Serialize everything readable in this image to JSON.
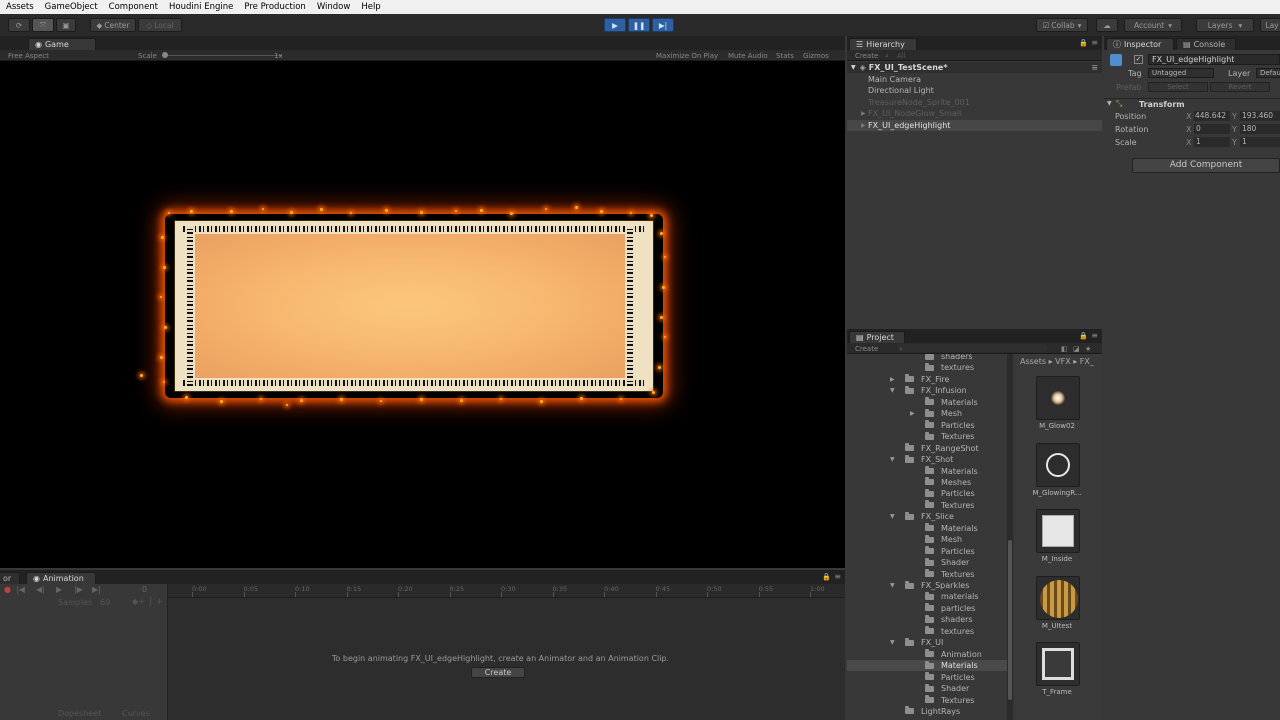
{
  "menu": [
    "Assets",
    "GameObject",
    "Component",
    "Houdini Engine",
    "Pre Production",
    "Window",
    "Help"
  ],
  "toolbar": {
    "pivot": "Center",
    "space": "Local",
    "collab": "Collab",
    "account": "Account",
    "layers": "Layers",
    "layout": "Lay"
  },
  "game": {
    "tab": "Game",
    "aspect": "Free Aspect",
    "scale_label": "Scale",
    "scale_value": "1x",
    "maximize": "Maximize On Play",
    "mute": "Mute Audio",
    "stats": "Stats",
    "gizmos": "Gizmos"
  },
  "hierarchy": {
    "tab": "Hierarchy",
    "create": "Create",
    "search": "All",
    "scene": "FX_UI_TestScene*",
    "items": [
      {
        "label": "Main Camera",
        "dim": false,
        "selected": false,
        "arrow": false
      },
      {
        "label": "Directional Light",
        "dim": false,
        "selected": false,
        "arrow": false
      },
      {
        "label": "TreasureNode_Sprite_001",
        "dim": true,
        "selected": false,
        "arrow": false
      },
      {
        "label": "FX_UI_NodeGlow_Small",
        "dim": true,
        "selected": false,
        "arrow": true
      },
      {
        "label": "FX_UI_edgeHighlight",
        "dim": false,
        "selected": true,
        "arrow": true
      }
    ]
  },
  "inspector": {
    "tab": "Inspector",
    "console_tab": "Console",
    "object_name": "FX_UI_edgeHighlight",
    "tag_label": "Tag",
    "tag_value": "Untagged",
    "layer_label": "Layer",
    "layer_value": "Default",
    "prefab_label": "Prefab",
    "select": "Select",
    "revert": "Revert",
    "component": "Transform",
    "position_label": "Position",
    "position_x": "448.642",
    "position_y": "193.460",
    "rotation_label": "Rotation",
    "rotation_x": "0",
    "rotation_y": "180",
    "scale_label": "Scale",
    "scale_x": "1",
    "scale_y": "1",
    "x": "X",
    "y": "Y",
    "add_component": "Add Component"
  },
  "project": {
    "tab": "Project",
    "create": "Create",
    "breadcrumb": "Assets ▸ VFX ▸ FX_",
    "tree": [
      {
        "label": "shaders",
        "indent": 2,
        "arrow": ""
      },
      {
        "label": "textures",
        "indent": 2,
        "arrow": ""
      },
      {
        "label": "FX_Fire",
        "indent": 1,
        "arrow": "▶"
      },
      {
        "label": "FX_Infusion",
        "indent": 1,
        "arrow": "▼"
      },
      {
        "label": "Materials",
        "indent": 2,
        "arrow": ""
      },
      {
        "label": "Mesh",
        "indent": 2,
        "arrow": "▶"
      },
      {
        "label": "Particles",
        "indent": 2,
        "arrow": ""
      },
      {
        "label": "Textures",
        "indent": 2,
        "arrow": ""
      },
      {
        "label": "FX_RangeShot",
        "indent": 1,
        "arrow": ""
      },
      {
        "label": "FX_Shot",
        "indent": 1,
        "arrow": "▼"
      },
      {
        "label": "Materials",
        "indent": 2,
        "arrow": ""
      },
      {
        "label": "Meshes",
        "indent": 2,
        "arrow": ""
      },
      {
        "label": "Particles",
        "indent": 2,
        "arrow": ""
      },
      {
        "label": "Textures",
        "indent": 2,
        "arrow": ""
      },
      {
        "label": "FX_Slice",
        "indent": 1,
        "arrow": "▼"
      },
      {
        "label": "Materials",
        "indent": 2,
        "arrow": ""
      },
      {
        "label": "Mesh",
        "indent": 2,
        "arrow": ""
      },
      {
        "label": "Particles",
        "indent": 2,
        "arrow": ""
      },
      {
        "label": "Shader",
        "indent": 2,
        "arrow": ""
      },
      {
        "label": "Textures",
        "indent": 2,
        "arrow": ""
      },
      {
        "label": "FX_Sparkles",
        "indent": 1,
        "arrow": "▼"
      },
      {
        "label": "materials",
        "indent": 2,
        "arrow": ""
      },
      {
        "label": "particles",
        "indent": 2,
        "arrow": ""
      },
      {
        "label": "shaders",
        "indent": 2,
        "arrow": ""
      },
      {
        "label": "textures",
        "indent": 2,
        "arrow": ""
      },
      {
        "label": "FX_UI",
        "indent": 1,
        "arrow": "▼"
      },
      {
        "label": "Animation",
        "indent": 2,
        "arrow": ""
      },
      {
        "label": "Materials",
        "indent": 2,
        "arrow": "",
        "selected": true
      },
      {
        "label": "Particles",
        "indent": 2,
        "arrow": ""
      },
      {
        "label": "Shader",
        "indent": 2,
        "arrow": ""
      },
      {
        "label": "Textures",
        "indent": 2,
        "arrow": ""
      },
      {
        "label": "LightRays",
        "indent": 1,
        "arrow": ""
      }
    ],
    "assets": [
      {
        "label": "M_Glow02",
        "kind": "glow"
      },
      {
        "label": "M_GlowingR...",
        "kind": "ring"
      },
      {
        "label": "M_Inside",
        "kind": "square"
      },
      {
        "label": "M_UItest",
        "kind": "ball"
      },
      {
        "label": "T_Frame",
        "kind": "frame"
      }
    ]
  },
  "animation": {
    "tab": "Animation",
    "left_tab": "or",
    "samples_label": "Samples",
    "samples_value": "60",
    "frame": "0",
    "ticks": [
      "0:00",
      "0:05",
      "0:10",
      "0:15",
      "0:20",
      "0:25",
      "0:30",
      "0:35",
      "0:40",
      "0:45",
      "0:50",
      "0:55",
      "1:00"
    ],
    "message": "To begin animating FX_UI_edgeHighlight, create an Animator and an Animation Clip.",
    "create_button": "Create",
    "dopesheet": "Dopesheet",
    "curves": "Curves"
  }
}
